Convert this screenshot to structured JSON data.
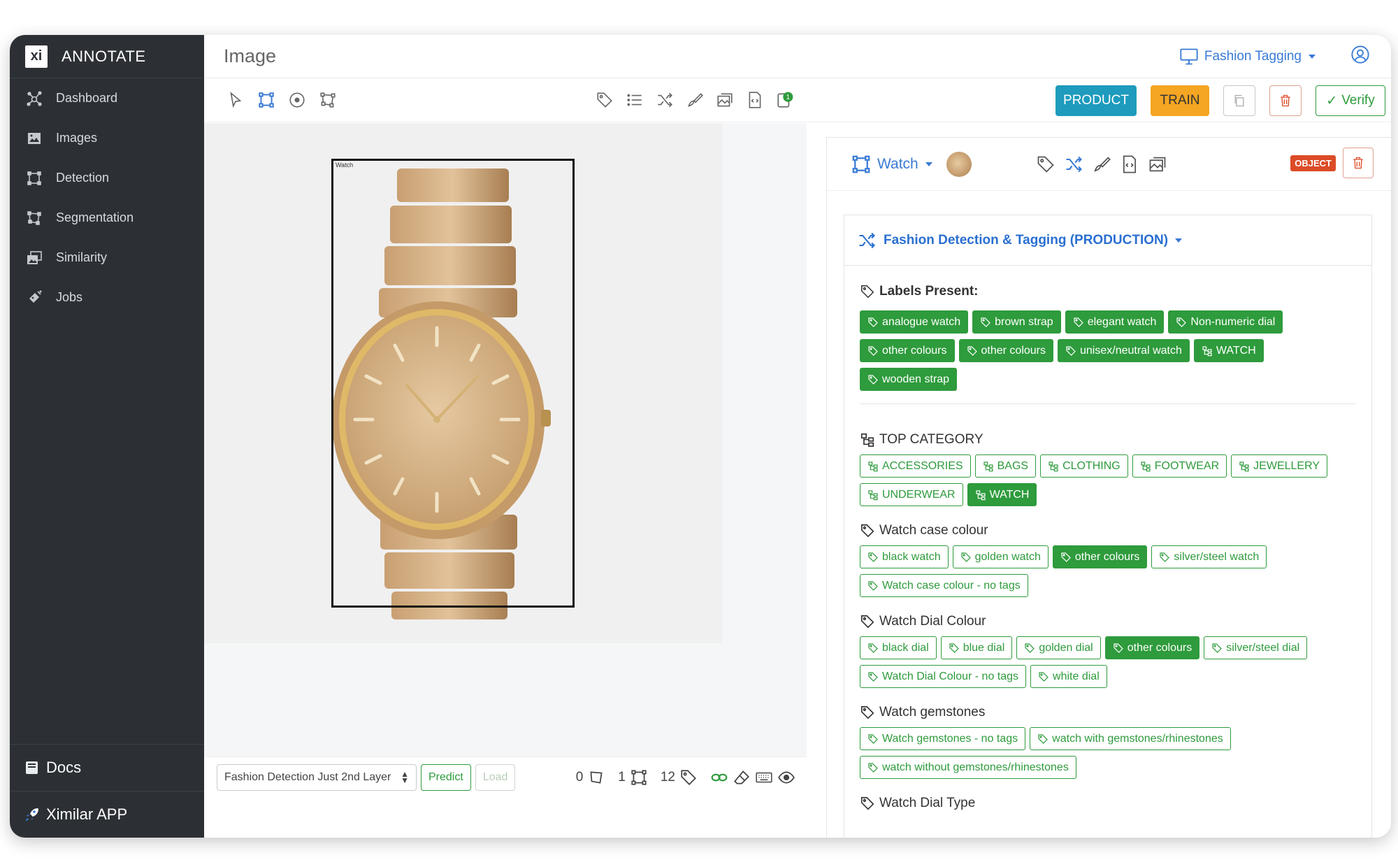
{
  "brand": {
    "logo": "xi",
    "name": "ANNOTATE"
  },
  "sidebar": {
    "items": [
      {
        "label": "Dashboard",
        "icon": "dashboard-icon"
      },
      {
        "label": "Images",
        "icon": "images-icon"
      },
      {
        "label": "Detection",
        "icon": "detection-icon"
      },
      {
        "label": "Segmentation",
        "icon": "segmentation-icon"
      },
      {
        "label": "Similarity",
        "icon": "similarity-icon"
      },
      {
        "label": "Jobs",
        "icon": "jobs-icon"
      }
    ],
    "docs": "Docs",
    "app": "Ximilar APP"
  },
  "header": {
    "title": "Image",
    "project": "Fashion Tagging"
  },
  "toolbar": {
    "product": "PRODUCT",
    "train": "TRAIN",
    "verify": "Verify",
    "badge_count": "1"
  },
  "image": {
    "bbox_label": "Watch"
  },
  "bottom": {
    "model": "Fashion Detection Just 2nd Layer",
    "predict": "Predict",
    "load": "Load",
    "counts": [
      "0",
      "1",
      "12"
    ]
  },
  "object": {
    "name": "Watch",
    "badge": "OBJECT"
  },
  "task": {
    "title": "Fashion Detection & Tagging (PRODUCTION)"
  },
  "labels_present": {
    "title": "Labels Present:",
    "tags": [
      {
        "text": "analogue watch",
        "kind": "tag"
      },
      {
        "text": "brown strap",
        "kind": "tag"
      },
      {
        "text": "elegant watch",
        "kind": "tag"
      },
      {
        "text": "Non-numeric dial",
        "kind": "tag"
      },
      {
        "text": "other colours",
        "kind": "tag"
      },
      {
        "text": "other colours",
        "kind": "tag"
      },
      {
        "text": "unisex/neutral watch",
        "kind": "tag"
      },
      {
        "text": "WATCH",
        "kind": "cat"
      },
      {
        "text": "wooden strap",
        "kind": "tag"
      }
    ]
  },
  "sections": [
    {
      "title": "TOP CATEGORY",
      "icon": "category",
      "tags": [
        {
          "text": "ACCESSORIES",
          "on": false,
          "kind": "cat"
        },
        {
          "text": "BAGS",
          "on": false,
          "kind": "cat"
        },
        {
          "text": "CLOTHING",
          "on": false,
          "kind": "cat"
        },
        {
          "text": "FOOTWEAR",
          "on": false,
          "kind": "cat"
        },
        {
          "text": "JEWELLERY",
          "on": false,
          "kind": "cat"
        },
        {
          "text": "UNDERWEAR",
          "on": false,
          "kind": "cat"
        },
        {
          "text": "WATCH",
          "on": true,
          "kind": "cat"
        }
      ]
    },
    {
      "title": "Watch case colour",
      "icon": "tag",
      "tags": [
        {
          "text": "black watch",
          "on": false,
          "kind": "tag"
        },
        {
          "text": "golden watch",
          "on": false,
          "kind": "tag"
        },
        {
          "text": "other colours",
          "on": true,
          "kind": "tag"
        },
        {
          "text": "silver/steel watch",
          "on": false,
          "kind": "tag"
        },
        {
          "text": "Watch case colour - no tags",
          "on": false,
          "kind": "tag"
        }
      ]
    },
    {
      "title": "Watch Dial Colour",
      "icon": "tag",
      "tags": [
        {
          "text": "black dial",
          "on": false,
          "kind": "tag"
        },
        {
          "text": "blue dial",
          "on": false,
          "kind": "tag"
        },
        {
          "text": "golden dial",
          "on": false,
          "kind": "tag"
        },
        {
          "text": "other colours",
          "on": true,
          "kind": "tag"
        },
        {
          "text": "silver/steel dial",
          "on": false,
          "kind": "tag"
        },
        {
          "text": "Watch Dial Colour - no tags",
          "on": false,
          "kind": "tag"
        },
        {
          "text": "white dial",
          "on": false,
          "kind": "tag"
        }
      ]
    },
    {
      "title": "Watch gemstones",
      "icon": "tag",
      "tags": [
        {
          "text": "Watch gemstones - no tags",
          "on": false,
          "kind": "tag"
        },
        {
          "text": "watch with gemstones/rhinestones",
          "on": false,
          "kind": "tag"
        },
        {
          "text": "watch without gemstones/rhinestones",
          "on": false,
          "kind": "tag"
        }
      ]
    },
    {
      "title": "Watch Dial Type",
      "icon": "tag",
      "tags": []
    }
  ],
  "colors": {
    "sidebar": "#2c3035",
    "accent": "#3a7bd5",
    "green": "#2e9b3c",
    "product": "#1e9bbd",
    "train": "#f5a623",
    "danger": "#dc4b27"
  }
}
